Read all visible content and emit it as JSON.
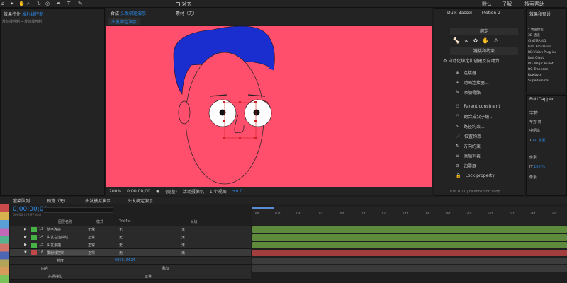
{
  "toolbar": {
    "default": "默认",
    "learn": "了解",
    "search": "搜索帮助",
    "snap": "对齐"
  },
  "left_panel": {
    "tab_effect": "效果控件",
    "tab_name": "发射线控制",
    "line1": "发射线控制 • 发射线控制"
  },
  "comp_panel": {
    "tab_prefix": "合成",
    "tab_name": "头发绑定演示",
    "footage": "素材（无）",
    "crumb": "头发绑定演示",
    "zoom": "200%",
    "time": "0;00;00;00",
    "quality": "(完整)",
    "camera": "活动摄像机",
    "view": "1 个视图",
    "offset": "+0.0"
  },
  "duik": {
    "tab": "Duik Bassel",
    "tab2": "Motion 2",
    "bind": "绑定",
    "autorig": "自动化绑定和创建反向动力",
    "links": [
      "连接器...",
      "动画连接器...",
      "添加骨骼"
    ],
    "constraint": "Parent constraint",
    "items": [
      "跨合成父子级...",
      "路径约束...",
      "位置约束",
      "方向约束",
      "添加列表",
      "归零器",
      "Lock property"
    ],
    "bind_bones": "链接和约束",
    "version": "v16.0.11 | rainboxprod.coop"
  },
  "effects": {
    "title": "效果和预设",
    "items": [
      "* 动画预设",
      "3D 通道",
      "CINEMA 4D",
      "Film Emulation",
      "RE:Vision Plug-ins",
      "Red Giant",
      "RG Magic Bullet",
      "RG Trapcode",
      "Rowbyte",
      "Superluminal"
    ]
  },
  "button_capper": "ButtCapper",
  "char": {
    "title": "字符",
    "font": "苹方-简",
    "style": "中粗体",
    "size": "40 像素",
    "track": "100 %",
    "leading": "像素",
    "unit": "像素"
  },
  "timeline": {
    "tabs": [
      "渲染队列",
      "预览（无）",
      "头发模拟演示",
      "头发绑定演示"
    ],
    "timecode": "0;00;00;00",
    "fps": "00000 (29.97 fps)",
    "cols": {
      "name": "图层名称",
      "mode": "模式",
      "trkmat": "TrkMat",
      "parent": "父级"
    },
    "layers": [
      {
        "num": "13",
        "name": "前子连续",
        "mode": "正常",
        "trk": "无",
        "parent": "无",
        "color": "#47b347"
      },
      {
        "num": "14",
        "name": "头发右边曲线",
        "mode": "正常",
        "trk": "无",
        "parent": "无",
        "color": "#47b347"
      },
      {
        "num": "15",
        "name": "头发素描",
        "mode": "正常",
        "trk": "无",
        "parent": "无",
        "color": "#47b347"
      },
      {
        "num": "16",
        "name": "发射线控制",
        "mode": "正常",
        "trk": "无",
        "parent": "无",
        "color": "#c24848"
      }
    ],
    "sublabel": "粒度",
    "content": "内容",
    "add": "添加",
    "stroke": "头发描边",
    "normal": "正常",
    "kf": "9856, 6624",
    "ruler": [
      "00f",
      "02f",
      "04f",
      "06f",
      "08f",
      "10f",
      "12f",
      "14f",
      "16f",
      "18f",
      "20f",
      "22f",
      "24f",
      "26f",
      "28f"
    ]
  },
  "colors": {
    "bg": "#ff4f6c",
    "hair": "#1a2ed0",
    "face": "#ff4f6c"
  }
}
